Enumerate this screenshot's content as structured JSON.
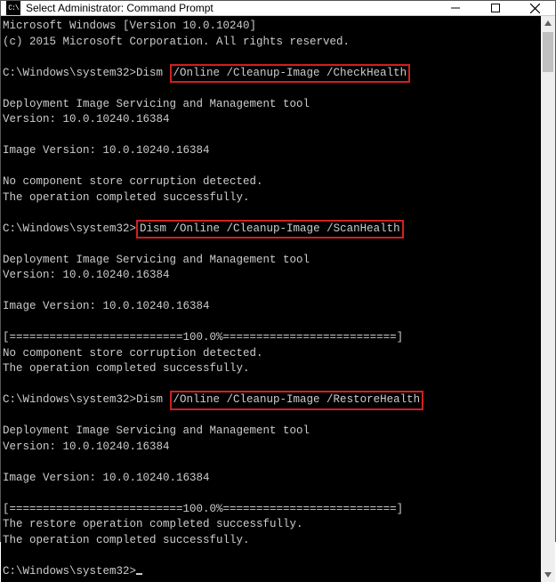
{
  "window": {
    "title": "Select Administrator: Command Prompt",
    "icon_label": "C:\\"
  },
  "terminal": {
    "line_ver1": "Microsoft Windows [Version 10.0.10240]",
    "line_ver2": "(c) 2015 Microsoft Corporation. All rights reserved.",
    "prompt1_prefix": "C:\\Windows\\system32>Dism ",
    "prompt1_hl": "/Online /Cleanup-Image /CheckHealth",
    "tool_header": "Deployment Image Servicing and Management tool",
    "tool_version": "Version: 10.0.10240.16384",
    "img_version": "Image Version: 10.0.10240.16384",
    "no_corruption": "No component store corruption detected.",
    "op_success": "The operation completed successfully.",
    "prompt2_prefix": "C:\\Windows\\system32>",
    "prompt2_hl": "Dism /Online /Cleanup-Image /ScanHealth",
    "progress_bar": "[==========================100.0%==========================]",
    "prompt3_prefix": "C:\\Windows\\system32>Dism ",
    "prompt3_hl": "/Online /Cleanup-Image /RestoreHealth",
    "restore_success": "The restore operation completed successfully.",
    "prompt_final": "C:\\Windows\\system32>"
  }
}
